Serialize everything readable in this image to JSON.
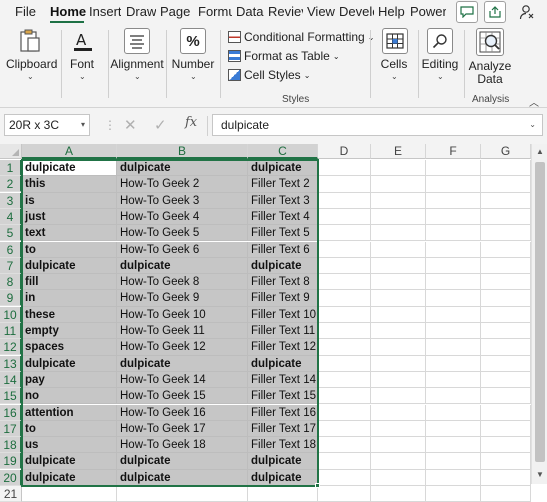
{
  "tabs": [
    "File",
    "Home",
    "Insert",
    "Draw",
    "Page L",
    "Formu",
    "Data",
    "Reviev",
    "View",
    "Develc",
    "Help",
    "Power"
  ],
  "active_tab": "Home",
  "ribbon": {
    "clipboard": "Clipboard",
    "font": "Font",
    "alignment": "Alignment",
    "number": "Number",
    "number_symbol": "%",
    "conditional_formatting": "Conditional Formatting",
    "format_as_table": "Format as Table",
    "cell_styles": "Cell Styles",
    "styles_group": "Styles",
    "cells": "Cells",
    "editing": "Editing",
    "analyze_data_line1": "Analyze",
    "analyze_data_line2": "Data",
    "analysis_group": "Analysis"
  },
  "formula_bar": {
    "name_box": "20R x 3C",
    "fx_label": "fx",
    "formula": "dulpicate"
  },
  "columns": [
    "A",
    "B",
    "C",
    "D",
    "E",
    "F",
    "G"
  ],
  "rows": [
    {
      "num": "1",
      "a": "dulpicate",
      "b": "dulpicate",
      "c": "dulpicate"
    },
    {
      "num": "2",
      "a": "this",
      "b": "How-To Geek  2",
      "c": "Filler Text 2"
    },
    {
      "num": "3",
      "a": "is",
      "b": "How-To Geek  3",
      "c": "Filler Text 3"
    },
    {
      "num": "4",
      "a": "just",
      "b": "How-To Geek  4",
      "c": "Filler Text 4"
    },
    {
      "num": "5",
      "a": "text",
      "b": "How-To Geek  5",
      "c": "Filler Text 5"
    },
    {
      "num": "6",
      "a": "to",
      "b": "How-To Geek  6",
      "c": "Filler Text 6"
    },
    {
      "num": "7",
      "a": "dulpicate",
      "b": "dulpicate",
      "c": "dulpicate"
    },
    {
      "num": "8",
      "a": "fill",
      "b": "How-To Geek  8",
      "c": "Filler Text 8"
    },
    {
      "num": "9",
      "a": "in",
      "b": "How-To Geek  9",
      "c": "Filler Text 9"
    },
    {
      "num": "10",
      "a": "these",
      "b": "How-To Geek  10",
      "c": "Filler Text 10"
    },
    {
      "num": "11",
      "a": "empty",
      "b": "How-To Geek  11",
      "c": "Filler Text 11"
    },
    {
      "num": "12",
      "a": "spaces",
      "b": "How-To Geek  12",
      "c": "Filler Text 12"
    },
    {
      "num": "13",
      "a": "dulpicate",
      "b": "dulpicate",
      "c": "dulpicate"
    },
    {
      "num": "14",
      "a": "pay",
      "b": "How-To Geek  14",
      "c": "Filler Text 14"
    },
    {
      "num": "15",
      "a": "no",
      "b": "How-To Geek  15",
      "c": "Filler Text 15"
    },
    {
      "num": "16",
      "a": "attention",
      "b": "How-To Geek  16",
      "c": "Filler Text 16"
    },
    {
      "num": "17",
      "a": "to",
      "b": "How-To Geek  17",
      "c": "Filler Text 17"
    },
    {
      "num": "18",
      "a": "us",
      "b": "How-To Geek  18",
      "c": "Filler Text 18"
    },
    {
      "num": "19",
      "a": "dulpicate",
      "b": "dulpicate",
      "c": "dulpicate"
    },
    {
      "num": "20",
      "a": "dulpicate",
      "b": "dulpicate",
      "c": "dulpicate"
    },
    {
      "num": "21",
      "a": "",
      "b": "",
      "c": ""
    }
  ],
  "colors": {
    "accent": "#217346",
    "selection": "#c6c6c6"
  }
}
